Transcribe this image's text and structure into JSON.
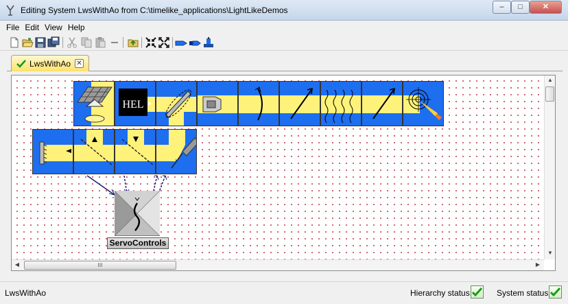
{
  "window": {
    "title": "Editing System LwsWithAo from C:\\timelike_applications\\LightLikeDemos",
    "minimize_glyph": "–",
    "maximize_glyph": "□",
    "close_glyph": "✕"
  },
  "menu": {
    "items": [
      {
        "label": "File"
      },
      {
        "label": "Edit"
      },
      {
        "label": "View"
      },
      {
        "label": "Help"
      }
    ]
  },
  "toolbar": {
    "buttons": [
      {
        "icon": "new-file-icon"
      },
      {
        "icon": "open-folder-icon"
      },
      {
        "icon": "save-icon"
      },
      {
        "icon": "save-all-icon"
      },
      {
        "icon": "cut-icon"
      },
      {
        "icon": "copy-icon"
      },
      {
        "icon": "paste-icon"
      },
      {
        "icon": "delete-icon"
      },
      {
        "icon": "go-up-icon"
      },
      {
        "icon": "collapse-icon"
      },
      {
        "icon": "expand-icon"
      },
      {
        "icon": "arrow-icon"
      },
      {
        "icon": "double-arrow-icon"
      },
      {
        "icon": "run-icon"
      }
    ]
  },
  "tab": {
    "label": "LwsWithAo",
    "status_icon": "green-check-icon",
    "close_glyph": "✕"
  },
  "diagram": {
    "hel_label": "HEL",
    "servo_label": "ServoControls",
    "blocks_top": [
      "detector-grid-block",
      "hel-source-block",
      "fsm-block",
      "telescope-block",
      "curved-mirror-block",
      "diagonal-mirror-block",
      "turbulence-block",
      "diagonal-mirror-block-2",
      "target-block"
    ],
    "blocks_bottom": [
      "wavefront-sensor-block",
      "beam-splitter-up-block",
      "beam-splitter-down-block",
      "deformable-mirror-block"
    ],
    "accent": "#1e6ef0",
    "beam_color": "#fff27a"
  },
  "scroll": {
    "hthumb_glyph": "III"
  },
  "status": {
    "left_text": "LwsWithAo",
    "hierarchy_label": "Hierarchy status:",
    "system_label": "System status:",
    "ok_color": "#2aa12a"
  }
}
